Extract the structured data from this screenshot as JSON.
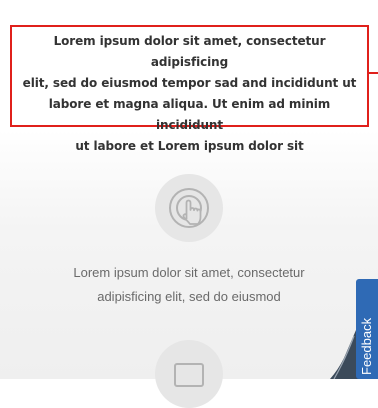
{
  "callout": {
    "lines": [
      "Lorem ipsum dolor sit amet, consectetur adipisficing",
      "elit, sed do eiusmod tempor sad and incididunt ut",
      "labore et magna aliqua. Ut enim ad minim incididunt",
      "ut labore et Lorem ipsum dolor sit"
    ],
    "border_color": "#e0201b"
  },
  "feature": {
    "icon": "touch-hand-icon",
    "lines": [
      "Lorem ipsum dolor sit amet, consectetur",
      "adipisficing elit, sed do eiusmod"
    ]
  },
  "second_feature": {
    "icon": "window-icon"
  },
  "feedback": {
    "label": "Feedback",
    "color": "#2f6ab5"
  }
}
